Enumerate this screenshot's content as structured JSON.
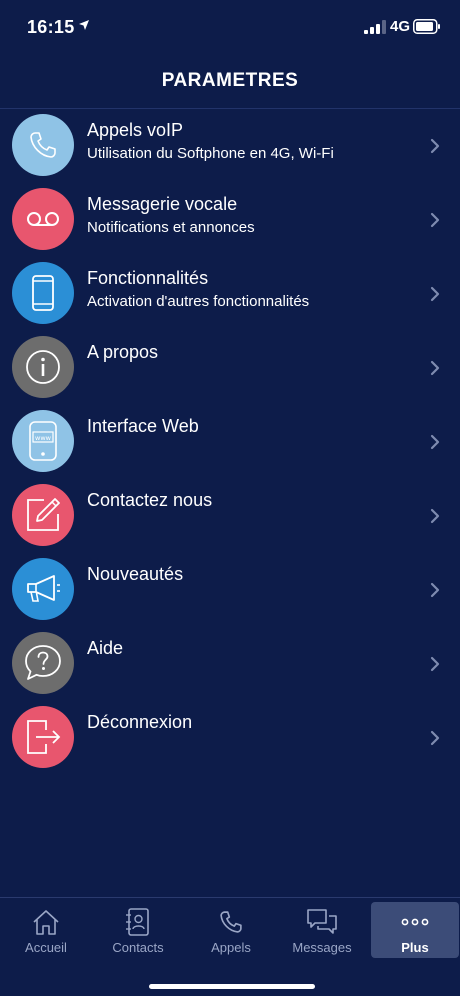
{
  "status": {
    "time": "16:15",
    "network": "4G"
  },
  "header": {
    "title": "PARAMETRES"
  },
  "settings": [
    {
      "title": "Appels voIP",
      "subtitle": "Utilisation du Softphone en 4G, Wi-Fi",
      "icon": "phone-icon",
      "color": "#8fc3e6"
    },
    {
      "title": "Messagerie vocale",
      "subtitle": "Notifications et annonces",
      "icon": "voicemail-icon",
      "color": "#e8566e"
    },
    {
      "title": "Fonctionnalités",
      "subtitle": "Activation d'autres fonctionnalités",
      "icon": "smartphone-icon",
      "color": "#2b8fd6"
    },
    {
      "title": "A propos",
      "subtitle": "",
      "icon": "info-icon",
      "color": "#6d6d6d"
    },
    {
      "title": "Interface Web",
      "subtitle": "",
      "icon": "web-phone-icon",
      "color": "#8fc3e6"
    },
    {
      "title": "Contactez nous",
      "subtitle": "",
      "icon": "edit-icon",
      "color": "#e8566e"
    },
    {
      "title": "Nouveautés",
      "subtitle": "",
      "icon": "megaphone-icon",
      "color": "#2b8fd6"
    },
    {
      "title": "Aide",
      "subtitle": "",
      "icon": "question-icon",
      "color": "#6d6d6d"
    },
    {
      "title": "Déconnexion",
      "subtitle": "",
      "icon": "logout-icon",
      "color": "#e8566e"
    }
  ],
  "tabs": [
    {
      "label": "Accueil",
      "icon": "home-icon"
    },
    {
      "label": "Contacts",
      "icon": "contacts-icon"
    },
    {
      "label": "Appels",
      "icon": "phone-icon"
    },
    {
      "label": "Messages",
      "icon": "messages-icon"
    },
    {
      "label": "Plus",
      "icon": "more-icon",
      "active": true
    }
  ],
  "colors": {
    "background": "#0d1c4a",
    "tab_active": "#3c4c78",
    "chevron": "#7e8bb0"
  }
}
